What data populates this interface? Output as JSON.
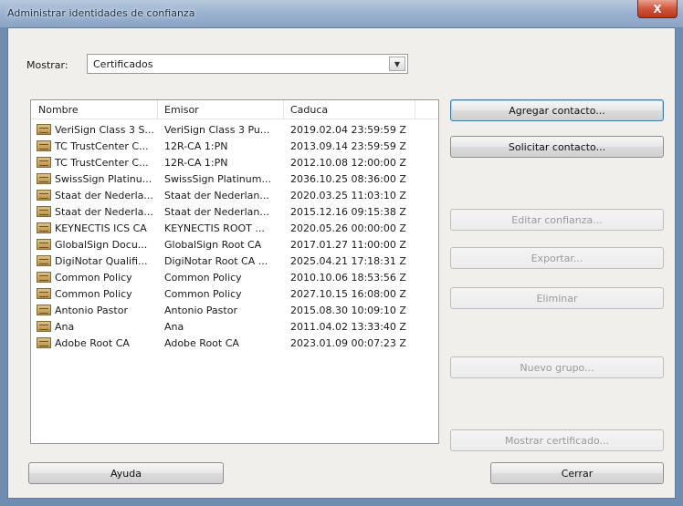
{
  "window": {
    "title": "Administrar identidades de confianza",
    "close_glyph": "X"
  },
  "filter": {
    "label": "Mostrar:",
    "selected": "Certificados",
    "arrow_glyph": "▼"
  },
  "table": {
    "columns": [
      "Nombre",
      "Emisor",
      "Caduca"
    ],
    "rows": [
      {
        "name": "VeriSign Class 3 S...",
        "issuer": "VeriSign Class 3 Pu...",
        "expires": "2019.02.04 23:59:59 Z"
      },
      {
        "name": "TC TrustCenter C...",
        "issuer": "12R-CA 1:PN",
        "expires": "2013.09.14 23:59:59 Z"
      },
      {
        "name": "TC TrustCenter C...",
        "issuer": "12R-CA 1:PN",
        "expires": "2012.10.08 12:00:00 Z"
      },
      {
        "name": "SwissSign Platinu...",
        "issuer": "SwissSign Platinum...",
        "expires": "2036.10.25 08:36:00 Z"
      },
      {
        "name": "Staat der Nederla...",
        "issuer": "Staat der Nederlan...",
        "expires": "2020.03.25 11:03:10 Z"
      },
      {
        "name": "Staat der Nederla...",
        "issuer": "Staat der Nederlan...",
        "expires": "2015.12.16 09:15:38 Z"
      },
      {
        "name": "KEYNECTIS ICS CA",
        "issuer": "KEYNECTIS ROOT ...",
        "expires": "2020.05.26 00:00:00 Z"
      },
      {
        "name": "GlobalSign Docu...",
        "issuer": "GlobalSign Root CA",
        "expires": "2017.01.27 11:00:00 Z"
      },
      {
        "name": "DigiNotar Qualifi...",
        "issuer": "DigiNotar Root CA ...",
        "expires": "2025.04.21 17:18:31 Z"
      },
      {
        "name": "Common Policy",
        "issuer": "Common Policy",
        "expires": "2010.10.06 18:53:56 Z"
      },
      {
        "name": "Common Policy",
        "issuer": "Common Policy",
        "expires": "2027.10.15 16:08:00 Z"
      },
      {
        "name": "Antonio Pastor",
        "issuer": "Antonio Pastor",
        "expires": "2015.08.30 10:09:10 Z"
      },
      {
        "name": "Ana",
        "issuer": "Ana",
        "expires": "2011.04.02 13:33:40 Z"
      },
      {
        "name": "Adobe Root CA",
        "issuer": "Adobe Root CA",
        "expires": "2023.01.09 00:07:23 Z"
      }
    ]
  },
  "buttons": {
    "add_contact": "Agregar contacto...",
    "request_contact": "Solicitar contacto...",
    "edit_trust": "Editar confianza...",
    "export": "Exportar...",
    "delete": "Eliminar",
    "new_group": "Nuevo grupo...",
    "show_certificate": "Mostrar certificado...",
    "help": "Ayuda",
    "close": "Cerrar"
  },
  "icons": {
    "row_icon": "certificate-icon",
    "dropdown": "chevron-down-icon"
  }
}
